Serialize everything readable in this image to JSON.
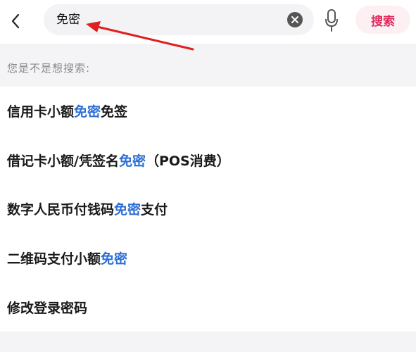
{
  "search": {
    "query": "免密",
    "button_label": "搜索"
  },
  "hint": "您是不是想搜索:",
  "suggestions": [
    {
      "before": "信用卡小额",
      "highlight": "免密",
      "after": "免签"
    },
    {
      "before": "借记卡小额/凭签名",
      "highlight": "免密",
      "after": "（POS消费）"
    },
    {
      "before": "数字人民币付钱码",
      "highlight": "免密",
      "after": "支付"
    },
    {
      "before": "二维码支付小额",
      "highlight": "免密",
      "after": ""
    },
    {
      "before": "修改登录密码",
      "highlight": "",
      "after": ""
    }
  ],
  "icons": {
    "back": "chevron-left-icon",
    "clear": "clear-circle-icon",
    "mic": "microphone-icon"
  },
  "colors": {
    "accent": "#e2285c",
    "highlight": "#2d6fd6",
    "annotation_arrow": "#e02020"
  }
}
